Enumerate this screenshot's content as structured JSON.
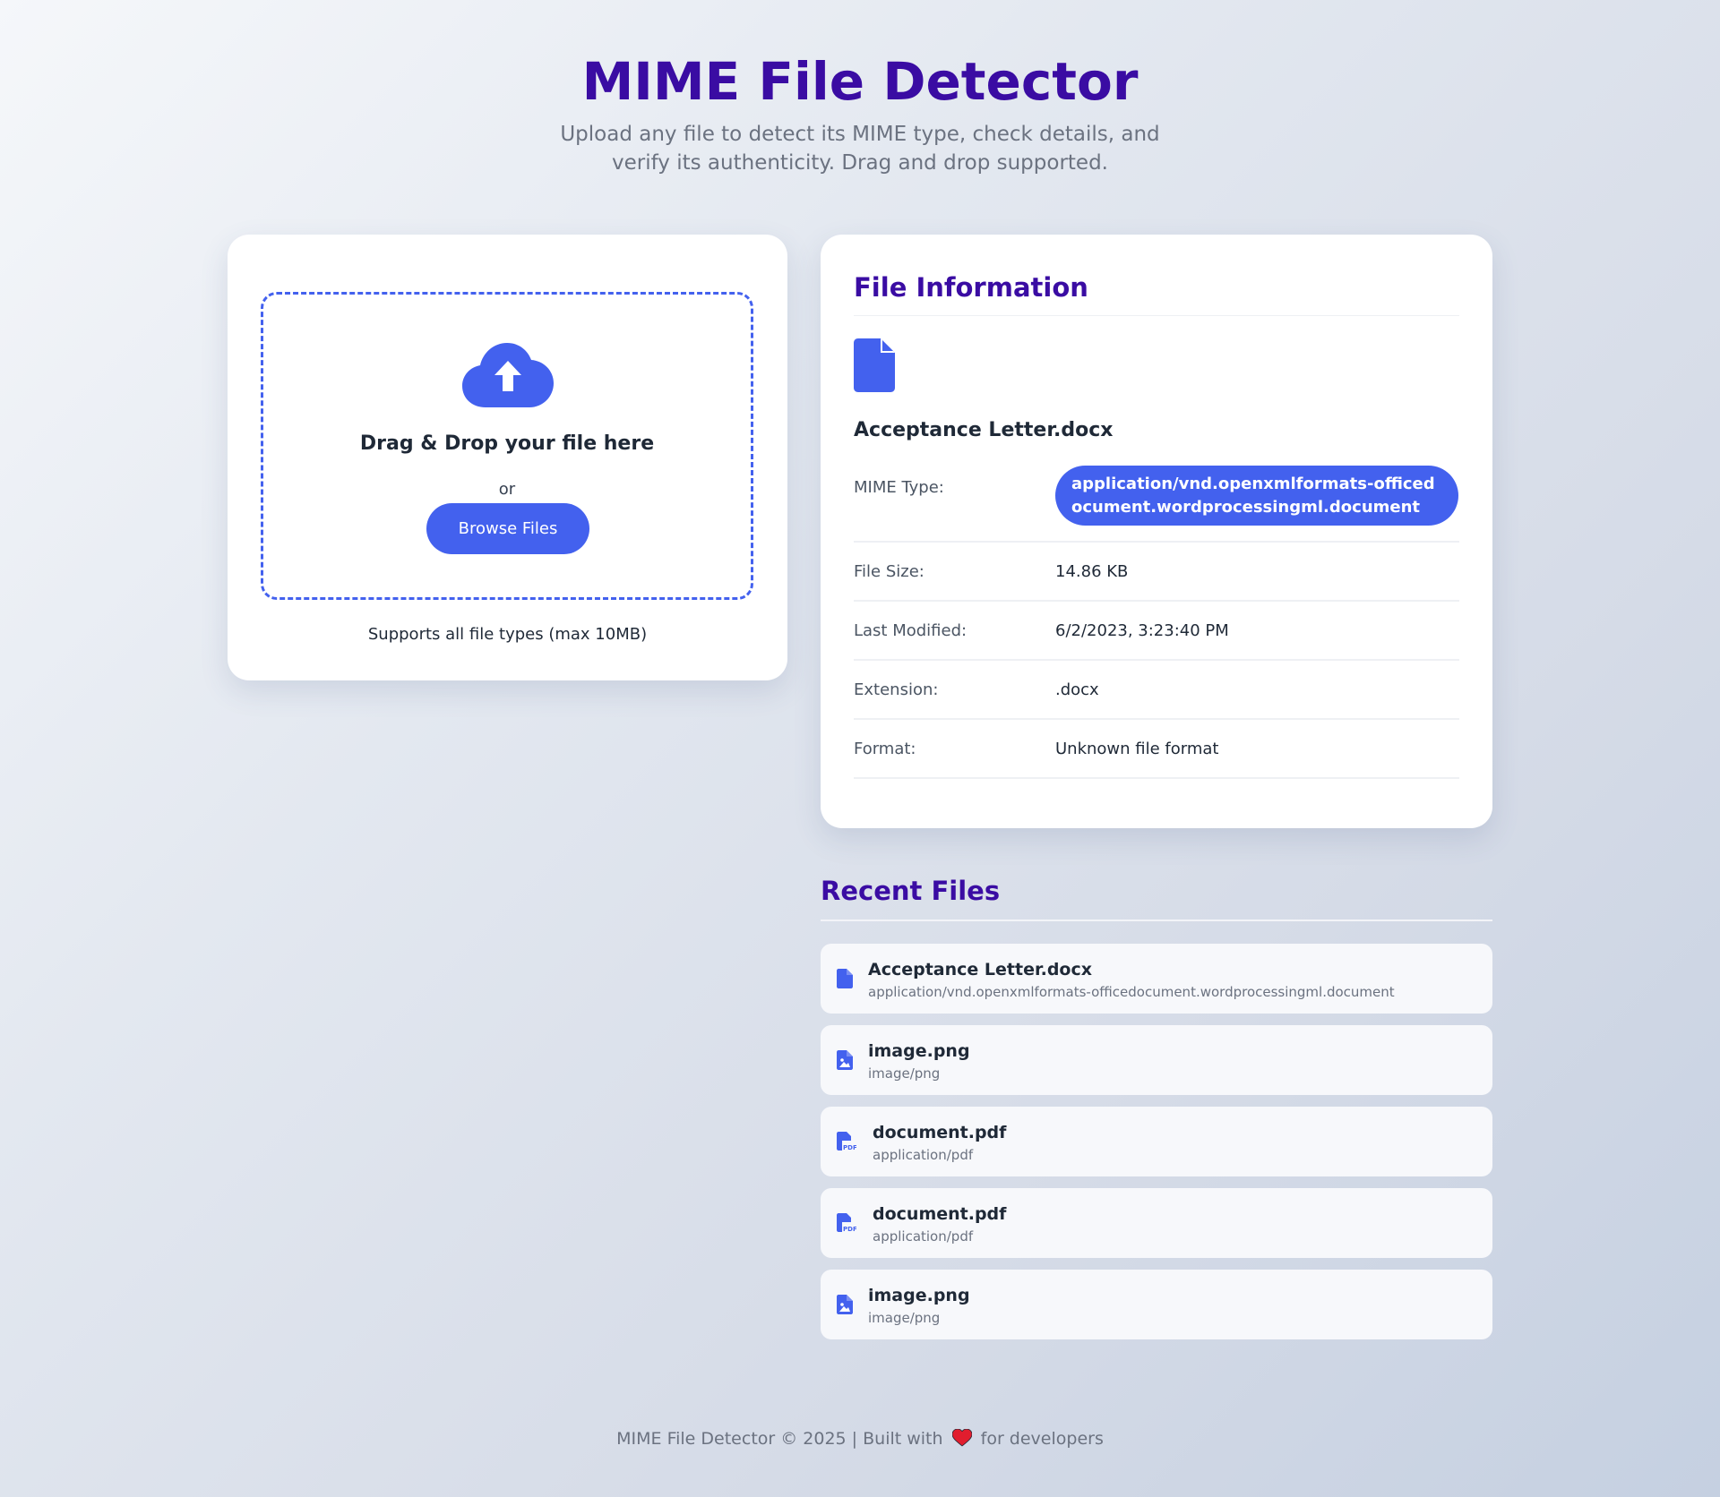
{
  "header": {
    "title": "MIME File Detector",
    "subtitle": "Upload any file to detect its MIME type, check details, and verify its authenticity. Drag and drop supported."
  },
  "upload": {
    "icon": "cloud-upload-icon",
    "drop_text": "Drag & Drop your file here",
    "or_text": "or",
    "browse_label": "Browse Files",
    "supports_text": "Supports all file types (max 10MB)"
  },
  "file_info": {
    "title": "File Information",
    "icon": "file-icon",
    "file_name": "Acceptance Letter.docx",
    "rows": [
      {
        "label": "MIME Type:",
        "value": "application/vnd.openxmlformats-officedocument.wordprocessingml.document"
      },
      {
        "label": "File Size:",
        "value": "14.86 KB"
      },
      {
        "label": "Last Modified:",
        "value": "6/2/2023, 3:23:40 PM"
      },
      {
        "label": "Extension:",
        "value": ".docx"
      },
      {
        "label": "Format:",
        "value": "Unknown file format"
      }
    ]
  },
  "recent": {
    "title": "Recent Files",
    "items": [
      {
        "name": "Acceptance Letter.docx",
        "type": "application/vnd.openxmlformats-officedocument.wordprocessingml.document",
        "icon": "file-icon"
      },
      {
        "name": "image.png",
        "type": "image/png",
        "icon": "file-image-icon"
      },
      {
        "name": "document.pdf",
        "type": "application/pdf",
        "icon": "file-pdf-icon"
      },
      {
        "name": "document.pdf",
        "type": "application/pdf",
        "icon": "file-pdf-icon"
      },
      {
        "name": "image.png",
        "type": "image/png",
        "icon": "file-image-icon"
      }
    ]
  },
  "footer": {
    "text_before": "MIME File Detector © 2025 | Built with",
    "icon": "heart-icon",
    "text_after": "for developers"
  },
  "colors": {
    "accent": "#4361ee",
    "heading": "#3a0ca3",
    "heart": "#e11d2e"
  }
}
